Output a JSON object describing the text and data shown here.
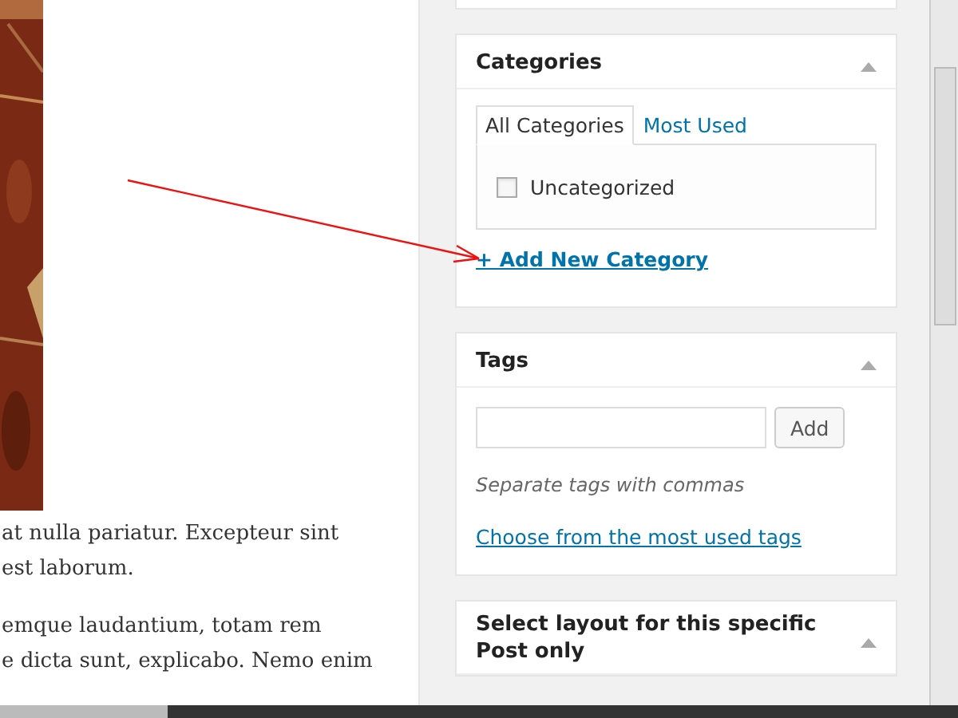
{
  "editor": {
    "paragraphs": [
      [
        "at nulla pariatur. Excepteur sint",
        "est laborum."
      ],
      [
        "emque laudantium, totam rem",
        "e dicta sunt, explicabo. Nemo enim"
      ]
    ]
  },
  "categories": {
    "title": "Categories",
    "expanded": true,
    "tabs": [
      {
        "label": "All Categories",
        "selected": true
      },
      {
        "label": "Most Used",
        "selected": false
      }
    ],
    "items": [
      {
        "label": "Uncategorized",
        "checked": false
      }
    ],
    "add_link": "+ Add New Category"
  },
  "tags": {
    "title": "Tags",
    "expanded": true,
    "button": "Add",
    "hint": "Separate tags with commas",
    "link": "Choose from the most used tags"
  },
  "layout_box": {
    "title": "Select layout for this specific Post only",
    "expanded": true
  },
  "annotation": {
    "kind": "arrow"
  }
}
